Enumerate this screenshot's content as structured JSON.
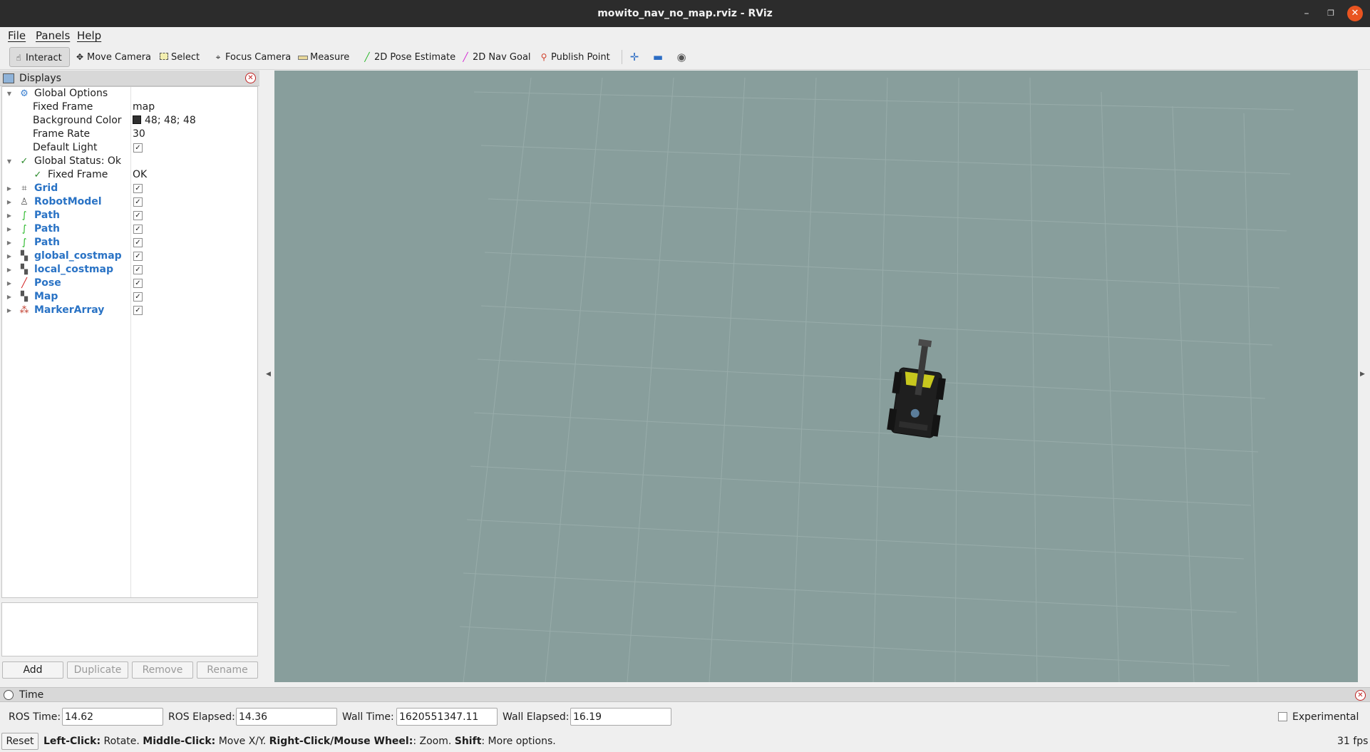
{
  "window": {
    "title": "mowito_nav_no_map.rviz - RViz"
  },
  "menu": [
    "File",
    "Panels",
    "Help"
  ],
  "toolbar": {
    "interact": "Interact",
    "move_camera": "Move Camera",
    "select": "Select",
    "focus_camera": "Focus Camera",
    "measure": "Measure",
    "pose_estimate": "2D Pose Estimate",
    "nav_goal": "2D Nav Goal",
    "publish_point": "Publish Point"
  },
  "displays": {
    "title": "Displays",
    "global_options": {
      "label": "Global Options",
      "fixed_frame_label": "Fixed Frame",
      "fixed_frame_value": "map",
      "background_color_label": "Background Color",
      "background_color_value": "48; 48; 48",
      "background_color_hex": "#303030",
      "frame_rate_label": "Frame Rate",
      "frame_rate_value": "30",
      "default_light_label": "Default Light",
      "default_light_checked": true
    },
    "global_status": {
      "label": "Global Status: Ok",
      "fixed_frame_label": "Fixed Frame",
      "fixed_frame_value": "OK"
    },
    "items": [
      {
        "label": "Grid",
        "icon": "grid-icon",
        "checked": true
      },
      {
        "label": "RobotModel",
        "icon": "robot-model-icon",
        "checked": true
      },
      {
        "label": "Path",
        "icon": "path-icon",
        "checked": true
      },
      {
        "label": "Path",
        "icon": "path-icon",
        "checked": true
      },
      {
        "label": "Path",
        "icon": "path-icon",
        "checked": true
      },
      {
        "label": "global_costmap",
        "icon": "map-icon",
        "checked": true
      },
      {
        "label": "local_costmap",
        "icon": "map-icon",
        "checked": true
      },
      {
        "label": "Pose",
        "icon": "pose-icon",
        "checked": true
      },
      {
        "label": "Map",
        "icon": "map-icon",
        "checked": true
      },
      {
        "label": "MarkerArray",
        "icon": "marker-array-icon",
        "checked": true
      }
    ],
    "buttons": {
      "add": "Add",
      "duplicate": "Duplicate",
      "remove": "Remove",
      "rename": "Rename"
    }
  },
  "viewport": {
    "background": "#889e9c",
    "robot_body": "#1f1f1f",
    "robot_accent": "#c8c81e"
  },
  "time": {
    "title": "Time",
    "ros_time_label": "ROS Time:",
    "ros_time": "14.62",
    "ros_elapsed_label": "ROS Elapsed:",
    "ros_elapsed": "14.36",
    "wall_time_label": "Wall Time:",
    "wall_time": "1620551347.11",
    "wall_elapsed_label": "Wall Elapsed:",
    "wall_elapsed": "16.19",
    "experimental_label": "Experimental",
    "experimental_checked": false
  },
  "status": {
    "reset": "Reset",
    "hint": [
      {
        "bold": "Left-Click:",
        "text": " Rotate. "
      },
      {
        "bold": "Middle-Click:",
        "text": " Move X/Y. "
      },
      {
        "bold": "Right-Click/Mouse Wheel:",
        "text": ": Zoom. "
      },
      {
        "bold": "Shift",
        "text": ": More options."
      }
    ],
    "fps": "31 fps"
  }
}
